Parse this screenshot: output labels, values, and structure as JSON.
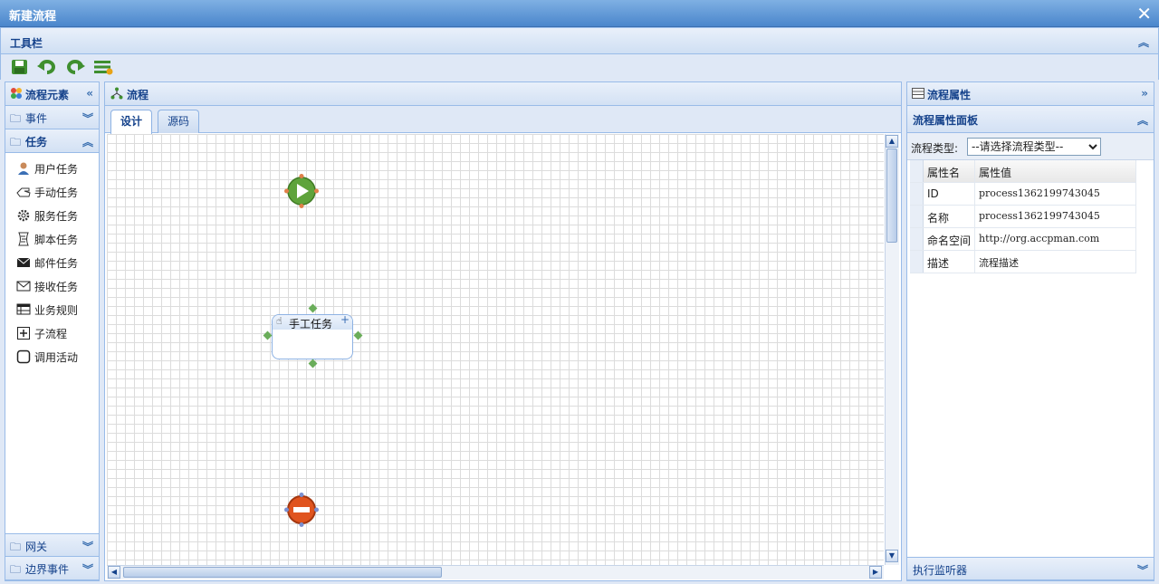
{
  "window": {
    "title": "新建流程"
  },
  "toolbar": {
    "title": "工具栏",
    "buttons": [
      "save-icon",
      "undo-icon",
      "redo-icon",
      "list-icon"
    ]
  },
  "left": {
    "title": "流程元素",
    "groups": [
      {
        "label": "事件"
      },
      {
        "label": "任务"
      },
      {
        "label": "网关"
      },
      {
        "label": "边界事件"
      }
    ],
    "tasks": [
      {
        "label": "用户任务",
        "icon": "user-icon"
      },
      {
        "label": "手动任务",
        "icon": "hand-icon"
      },
      {
        "label": "服务任务",
        "icon": "gear-icon"
      },
      {
        "label": "脚本任务",
        "icon": "script-icon"
      },
      {
        "label": "邮件任务",
        "icon": "mail-icon"
      },
      {
        "label": "接收任务",
        "icon": "envelope-icon"
      },
      {
        "label": "业务规则",
        "icon": "table-icon"
      },
      {
        "label": "子流程",
        "icon": "plus-box-icon"
      },
      {
        "label": "调用活动",
        "icon": "box-icon"
      }
    ]
  },
  "center": {
    "title": "流程",
    "tabs": [
      "设计",
      "源码"
    ],
    "active_tab": "设计",
    "nodes": {
      "task_label": "手工任务"
    }
  },
  "right": {
    "title": "流程属性",
    "panel_title": "流程属性面板",
    "type_label": "流程类型:",
    "type_value": "--请选择流程类型--",
    "grid_headers": [
      "属性名",
      "属性值"
    ],
    "rows": [
      {
        "name": "ID",
        "value": "process1362199743045"
      },
      {
        "name": "名称",
        "value": "process1362199743045"
      },
      {
        "name": "命名空间",
        "value": "http://org.accpman.com"
      },
      {
        "name": "描述",
        "value": "流程描述"
      }
    ],
    "listener_label": "执行监听器"
  },
  "colors": {
    "accent": "#15428b",
    "border": "#99bbe8",
    "header_bg": "#dfe8f6"
  }
}
